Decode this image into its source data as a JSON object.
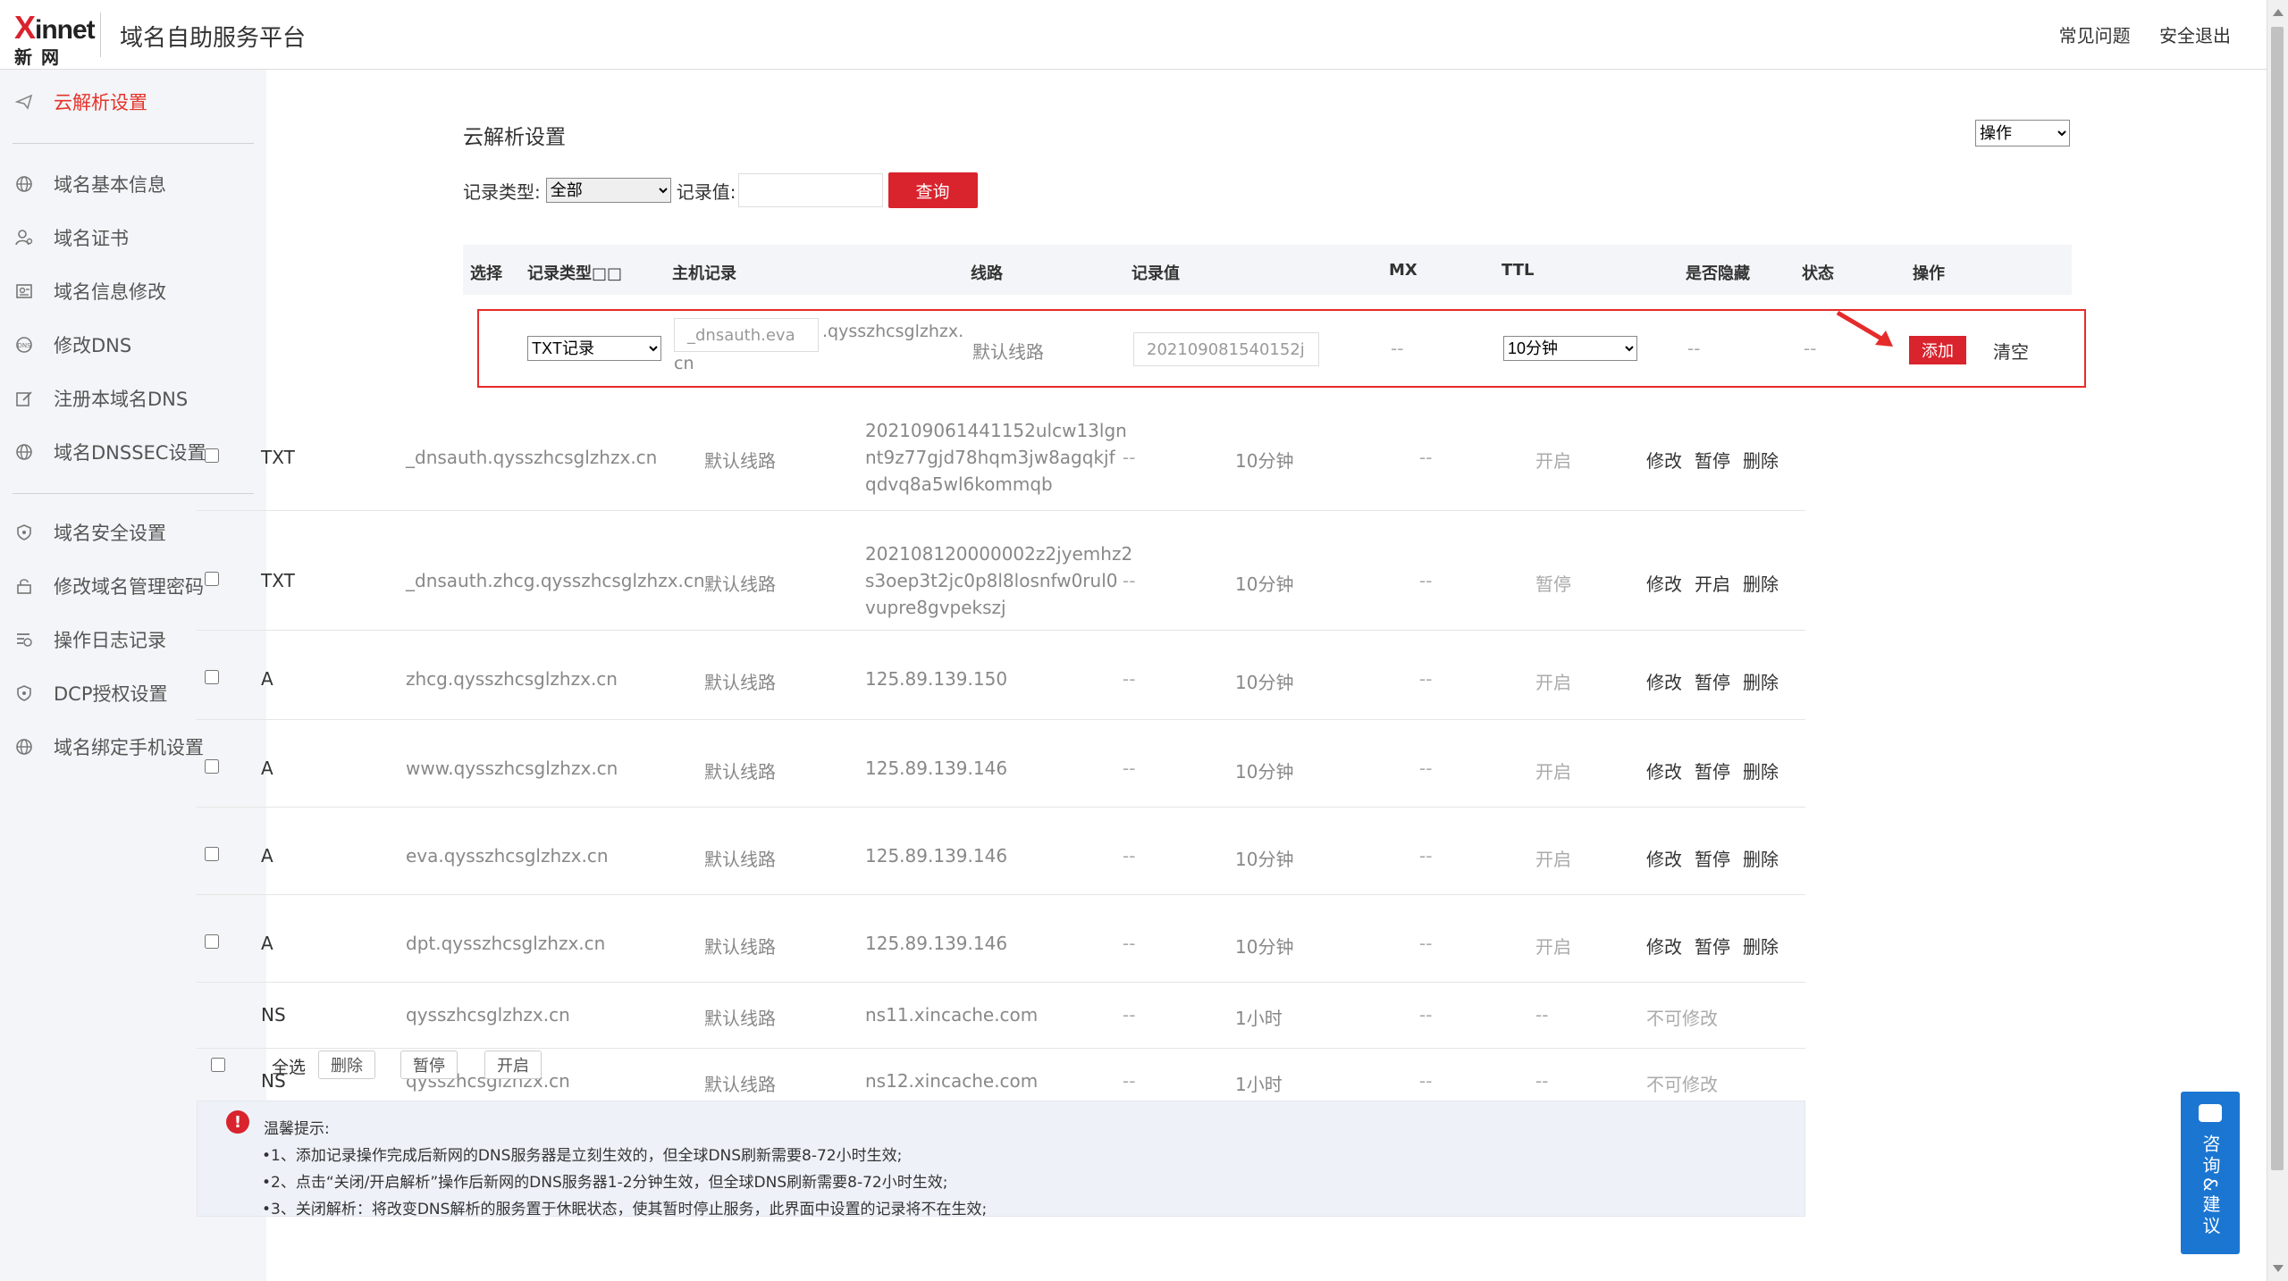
{
  "header": {
    "logo_brand": "Xinnet",
    "logo_cn": "新网",
    "app_title": "域名自助服务平台",
    "links": [
      "常见问题",
      "安全退出"
    ]
  },
  "sidebar": {
    "items": [
      {
        "label": "云解析设置",
        "icon": "paper-plane-icon",
        "active": true
      },
      {
        "label": "域名基本信息",
        "icon": "globe-icon"
      },
      {
        "label": "域名证书",
        "icon": "user-cert-icon"
      },
      {
        "label": "域名信息修改",
        "icon": "edit-card-icon"
      },
      {
        "label": "修改DNS",
        "icon": "dns-icon"
      },
      {
        "label": "注册本域名DNS",
        "icon": "register-edit-icon"
      },
      {
        "label": "域名DNSSEC设置",
        "icon": "globe-icon"
      },
      {
        "label": "域名安全设置",
        "icon": "shield-icon"
      },
      {
        "label": "修改域名管理密码",
        "icon": "lock-icon"
      },
      {
        "label": "操作日志记录",
        "icon": "log-list-icon"
      },
      {
        "label": "DCP授权设置",
        "icon": "shield-icon"
      },
      {
        "label": "域名绑定手机设置",
        "icon": "globe-icon"
      }
    ]
  },
  "main": {
    "title": "云解析设置",
    "op_select": "操作",
    "filter": {
      "type_label": "记录类型:",
      "type_value": "全部",
      "value_label": "记录值:",
      "value_placeholder": "",
      "query_button": "查询"
    },
    "columns": [
      "选择",
      "记录类型□□",
      "主机记录",
      "线路",
      "记录值",
      "MX",
      "TTL",
      "是否隐藏",
      "状态",
      "操作"
    ],
    "add_row": {
      "type": "TXT记录",
      "host_value": "_dnsauth.eva",
      "host_suffix_1": ".qysszhcsglzhzx.",
      "host_suffix_2": "cn",
      "line": "默认线路",
      "record_value": "202109081540152j",
      "mx": "--",
      "ttl": "10分钟",
      "hidden": "--",
      "status": "--",
      "add_button": "添加",
      "clear_button": "清空"
    },
    "rows": [
      {
        "type": "TXT",
        "host": "_dnsauth.qysszhcsglzhzx.cn",
        "line": "默认线路",
        "value": [
          "202109061441152ulcw13lgn",
          "nt9z77gjd78hqm3jw8agqkjf",
          "qdvq8a5wl6kommqb"
        ],
        "mx": "--",
        "ttl": "10分钟",
        "hidden": "--",
        "status": "开启",
        "actions": [
          "修改",
          "暂停",
          "删除"
        ]
      },
      {
        "type": "TXT",
        "host": "_dnsauth.zhcg.qysszhcsglzhzx.cn",
        "line": "默认线路",
        "value": [
          "202108120000002z2jyemhz2",
          "s3oep3t2jc0p8l8losnfw0rul0",
          "vupre8gvpekszj"
        ],
        "mx": "--",
        "ttl": "10分钟",
        "hidden": "--",
        "status": "暂停",
        "actions": [
          "修改",
          "开启",
          "删除"
        ]
      },
      {
        "type": "A",
        "host": "zhcg.qysszhcsglzhzx.cn",
        "line": "默认线路",
        "value": [
          "125.89.139.150"
        ],
        "mx": "--",
        "ttl": "10分钟",
        "hidden": "--",
        "status": "开启",
        "actions": [
          "修改",
          "暂停",
          "删除"
        ]
      },
      {
        "type": "A",
        "host": "www.qysszhcsglzhzx.cn",
        "line": "默认线路",
        "value": [
          "125.89.139.146"
        ],
        "mx": "--",
        "ttl": "10分钟",
        "hidden": "--",
        "status": "开启",
        "actions": [
          "修改",
          "暂停",
          "删除"
        ]
      },
      {
        "type": "A",
        "host": "eva.qysszhcsglzhzx.cn",
        "line": "默认线路",
        "value": [
          "125.89.139.146"
        ],
        "mx": "--",
        "ttl": "10分钟",
        "hidden": "--",
        "status": "开启",
        "actions": [
          "修改",
          "暂停",
          "删除"
        ]
      },
      {
        "type": "A",
        "host": "dpt.qysszhcsglzhzx.cn",
        "line": "默认线路",
        "value": [
          "125.89.139.146"
        ],
        "mx": "--",
        "ttl": "10分钟",
        "hidden": "--",
        "status": "开启",
        "actions": [
          "修改",
          "暂停",
          "删除"
        ]
      },
      {
        "type": "NS",
        "host": "qysszhcsglzhzx.cn",
        "line": "默认线路",
        "value": [
          "ns11.xincache.com"
        ],
        "mx": "--",
        "ttl": "1小时",
        "hidden": "--",
        "status": "--",
        "note": "不可修改"
      },
      {
        "type": "NS",
        "host": "qysszhcsglzhzx.cn",
        "line": "默认线路",
        "value": [
          "ns12.xincache.com"
        ],
        "mx": "--",
        "ttl": "1小时",
        "hidden": "--",
        "status": "--",
        "note": "不可修改"
      }
    ],
    "bulk": {
      "select_all": "全选",
      "delete": "删除",
      "pause": "暂停",
      "enable": "开启"
    },
    "notice": {
      "title": "温馨提示:",
      "lines": [
        "•1、添加记录操作完成后新网的DNS服务器是立刻生效的，但全球DNS刷新需要8-72小时生效;",
        "•2、点击“关闭/开启解析”操作后新网的DNS服务器1-2分钟生效，但全球DNS刷新需要8-72小时生效;",
        "•3、关闭解析：将改变DNS解析的服务置于休眠状态，使其暂时停止服务，此界面中设置的记录将不在生效;"
      ]
    }
  },
  "feedback": {
    "label": "咨询&建议"
  },
  "colors": {
    "accent": "#d9232d",
    "sidebar_bg": "#f4f5f8",
    "feedback_bg": "#1b76d2"
  }
}
